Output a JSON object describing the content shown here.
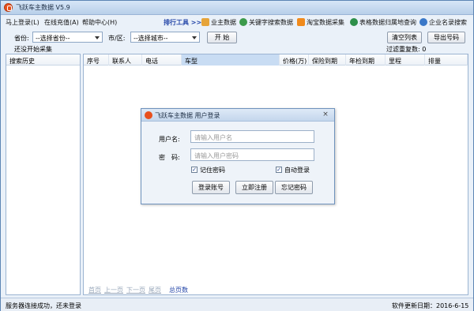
{
  "app": {
    "title": "飞跃车主数据 V5.9"
  },
  "menu": {
    "items": [
      "马上登录(L)",
      "在线充值(A)",
      "帮助中心(H)"
    ]
  },
  "toolbar": {
    "ranking_link": "排行工具 >>",
    "buttons": [
      {
        "label": "业主数据",
        "icon": "house-icon"
      },
      {
        "label": "关键字搜索数据",
        "icon": "search-icon"
      },
      {
        "label": "淘宝数据采集",
        "icon": "cart-icon"
      },
      {
        "label": "表格数据归属地查询",
        "icon": "globe-icon"
      },
      {
        "label": "企业名录搜索",
        "icon": "magnifier-icon"
      }
    ]
  },
  "filters": {
    "province_label": "省份:",
    "province_value": "--选择省份--",
    "city_label": "市/区:",
    "city_value": "--选择城市--",
    "start_button": "开 始",
    "clear_button": "清空列表",
    "export_button": "导出号码",
    "collect_status": "还没开始采集",
    "filter_count": "过滤重复数: 0"
  },
  "history": {
    "title": "搜索历史"
  },
  "table": {
    "columns": [
      "序号",
      "联系人",
      "电话",
      "车型",
      "价格(万)",
      "保险到期",
      "年检到期",
      "里程",
      "排量"
    ]
  },
  "pager": {
    "first": "首页",
    "prev": "上一页",
    "next": "下一页",
    "last": "尾页",
    "total": "总页数"
  },
  "status": {
    "left": "服务器连接成功，还未登录",
    "right": "软件更新日期：2016-6-15"
  },
  "login_dialog": {
    "title": "飞跃车主数据 用户登录",
    "close": "×",
    "username_label": "用户名:",
    "username_placeholder": "请输入用户名",
    "password_label": "密　码:",
    "password_placeholder": "请输入用户密码",
    "remember_label": "记住密码",
    "remember_checked": true,
    "autologin_label": "自动登录",
    "autologin_checked": true,
    "login_button": "登录账号",
    "register_button": "立即注册",
    "forgot_button": "忘记密码"
  }
}
